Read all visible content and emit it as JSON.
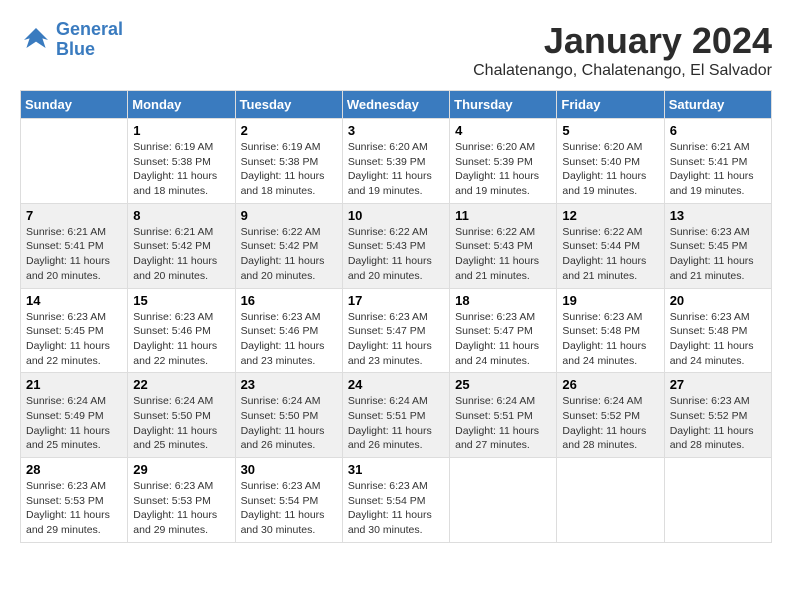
{
  "header": {
    "logo_line1": "General",
    "logo_line2": "Blue",
    "month_title": "January 2024",
    "subtitle": "Chalatenango, Chalatenango, El Salvador"
  },
  "days_of_week": [
    "Sunday",
    "Monday",
    "Tuesday",
    "Wednesday",
    "Thursday",
    "Friday",
    "Saturday"
  ],
  "weeks": [
    [
      {
        "day": "",
        "info": ""
      },
      {
        "day": "1",
        "info": "Sunrise: 6:19 AM\nSunset: 5:38 PM\nDaylight: 11 hours\nand 18 minutes."
      },
      {
        "day": "2",
        "info": "Sunrise: 6:19 AM\nSunset: 5:38 PM\nDaylight: 11 hours\nand 18 minutes."
      },
      {
        "day": "3",
        "info": "Sunrise: 6:20 AM\nSunset: 5:39 PM\nDaylight: 11 hours\nand 19 minutes."
      },
      {
        "day": "4",
        "info": "Sunrise: 6:20 AM\nSunset: 5:39 PM\nDaylight: 11 hours\nand 19 minutes."
      },
      {
        "day": "5",
        "info": "Sunrise: 6:20 AM\nSunset: 5:40 PM\nDaylight: 11 hours\nand 19 minutes."
      },
      {
        "day": "6",
        "info": "Sunrise: 6:21 AM\nSunset: 5:41 PM\nDaylight: 11 hours\nand 19 minutes."
      }
    ],
    [
      {
        "day": "7",
        "info": "Sunrise: 6:21 AM\nSunset: 5:41 PM\nDaylight: 11 hours\nand 20 minutes."
      },
      {
        "day": "8",
        "info": "Sunrise: 6:21 AM\nSunset: 5:42 PM\nDaylight: 11 hours\nand 20 minutes."
      },
      {
        "day": "9",
        "info": "Sunrise: 6:22 AM\nSunset: 5:42 PM\nDaylight: 11 hours\nand 20 minutes."
      },
      {
        "day": "10",
        "info": "Sunrise: 6:22 AM\nSunset: 5:43 PM\nDaylight: 11 hours\nand 20 minutes."
      },
      {
        "day": "11",
        "info": "Sunrise: 6:22 AM\nSunset: 5:43 PM\nDaylight: 11 hours\nand 21 minutes."
      },
      {
        "day": "12",
        "info": "Sunrise: 6:22 AM\nSunset: 5:44 PM\nDaylight: 11 hours\nand 21 minutes."
      },
      {
        "day": "13",
        "info": "Sunrise: 6:23 AM\nSunset: 5:45 PM\nDaylight: 11 hours\nand 21 minutes."
      }
    ],
    [
      {
        "day": "14",
        "info": "Sunrise: 6:23 AM\nSunset: 5:45 PM\nDaylight: 11 hours\nand 22 minutes."
      },
      {
        "day": "15",
        "info": "Sunrise: 6:23 AM\nSunset: 5:46 PM\nDaylight: 11 hours\nand 22 minutes."
      },
      {
        "day": "16",
        "info": "Sunrise: 6:23 AM\nSunset: 5:46 PM\nDaylight: 11 hours\nand 23 minutes."
      },
      {
        "day": "17",
        "info": "Sunrise: 6:23 AM\nSunset: 5:47 PM\nDaylight: 11 hours\nand 23 minutes."
      },
      {
        "day": "18",
        "info": "Sunrise: 6:23 AM\nSunset: 5:47 PM\nDaylight: 11 hours\nand 24 minutes."
      },
      {
        "day": "19",
        "info": "Sunrise: 6:23 AM\nSunset: 5:48 PM\nDaylight: 11 hours\nand 24 minutes."
      },
      {
        "day": "20",
        "info": "Sunrise: 6:23 AM\nSunset: 5:48 PM\nDaylight: 11 hours\nand 24 minutes."
      }
    ],
    [
      {
        "day": "21",
        "info": "Sunrise: 6:24 AM\nSunset: 5:49 PM\nDaylight: 11 hours\nand 25 minutes."
      },
      {
        "day": "22",
        "info": "Sunrise: 6:24 AM\nSunset: 5:50 PM\nDaylight: 11 hours\nand 25 minutes."
      },
      {
        "day": "23",
        "info": "Sunrise: 6:24 AM\nSunset: 5:50 PM\nDaylight: 11 hours\nand 26 minutes."
      },
      {
        "day": "24",
        "info": "Sunrise: 6:24 AM\nSunset: 5:51 PM\nDaylight: 11 hours\nand 26 minutes."
      },
      {
        "day": "25",
        "info": "Sunrise: 6:24 AM\nSunset: 5:51 PM\nDaylight: 11 hours\nand 27 minutes."
      },
      {
        "day": "26",
        "info": "Sunrise: 6:24 AM\nSunset: 5:52 PM\nDaylight: 11 hours\nand 28 minutes."
      },
      {
        "day": "27",
        "info": "Sunrise: 6:23 AM\nSunset: 5:52 PM\nDaylight: 11 hours\nand 28 minutes."
      }
    ],
    [
      {
        "day": "28",
        "info": "Sunrise: 6:23 AM\nSunset: 5:53 PM\nDaylight: 11 hours\nand 29 minutes."
      },
      {
        "day": "29",
        "info": "Sunrise: 6:23 AM\nSunset: 5:53 PM\nDaylight: 11 hours\nand 29 minutes."
      },
      {
        "day": "30",
        "info": "Sunrise: 6:23 AM\nSunset: 5:54 PM\nDaylight: 11 hours\nand 30 minutes."
      },
      {
        "day": "31",
        "info": "Sunrise: 6:23 AM\nSunset: 5:54 PM\nDaylight: 11 hours\nand 30 minutes."
      },
      {
        "day": "",
        "info": ""
      },
      {
        "day": "",
        "info": ""
      },
      {
        "day": "",
        "info": ""
      }
    ]
  ]
}
